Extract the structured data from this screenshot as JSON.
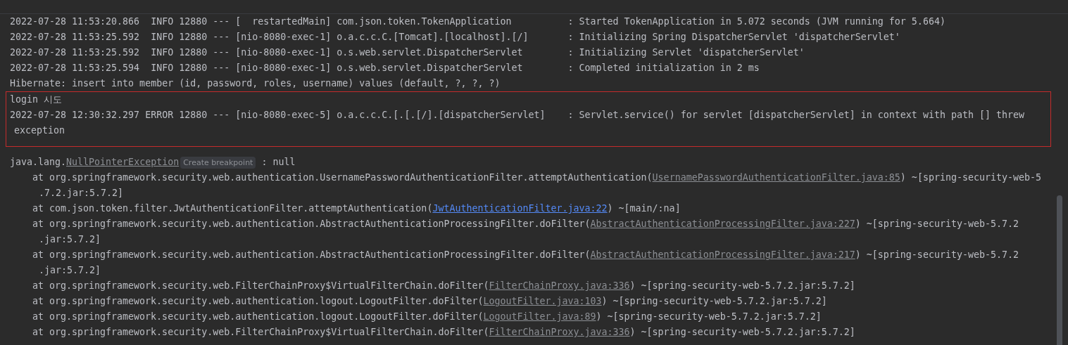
{
  "console": {
    "lines": [
      {
        "kind": "log",
        "boxed": false,
        "parts": [
          {
            "kind": "text",
            "text": "2022-07-28 11:53:20.866  INFO 12880 --- [  restartedMain] com.json.token.TokenApplication          : Started TokenApplication in 5.072 seconds (JVM running for 5.664)"
          }
        ]
      },
      {
        "kind": "log",
        "boxed": false,
        "parts": [
          {
            "kind": "text",
            "text": "2022-07-28 11:53:25.592  INFO 12880 --- [nio-8080-exec-1] o.a.c.c.C.[Tomcat].[localhost].[/]       : Initializing Spring DispatcherServlet 'dispatcherServlet'"
          }
        ]
      },
      {
        "kind": "log",
        "boxed": false,
        "parts": [
          {
            "kind": "text",
            "text": "2022-07-28 11:53:25.592  INFO 12880 --- [nio-8080-exec-1] o.s.web.servlet.DispatcherServlet        : Initializing Servlet 'dispatcherServlet'"
          }
        ]
      },
      {
        "kind": "log",
        "boxed": false,
        "parts": [
          {
            "kind": "text",
            "text": "2022-07-28 11:53:25.594  INFO 12880 --- [nio-8080-exec-1] o.s.web.servlet.DispatcherServlet        : Completed initialization in 2 ms"
          }
        ]
      },
      {
        "kind": "log",
        "boxed": false,
        "parts": [
          {
            "kind": "text",
            "text": "Hibernate: insert into member (id, password, roles, username) values (default, ?, ?, ?)"
          }
        ]
      },
      {
        "kind": "log",
        "boxed": true,
        "parts": [
          {
            "kind": "text",
            "text": "login 시도"
          }
        ]
      },
      {
        "kind": "log",
        "boxed": true,
        "parts": [
          {
            "kind": "text",
            "text": "2022-07-28 12:30:32.297 ERROR 12880 --- [nio-8080-exec-5] o.a.c.c.C.[.[.[/].[dispatcherServlet]    : Servlet.service() for servlet [dispatcherServlet] in context with path [] threw"
          }
        ]
      },
      {
        "kind": "wrap",
        "boxed": true,
        "parts": [
          {
            "kind": "text",
            "text": "exception"
          }
        ]
      },
      {
        "kind": "log",
        "boxed": false,
        "parts": [
          {
            "kind": "text",
            "text": "java.lang."
          },
          {
            "kind": "library-link",
            "text": "NullPointerException"
          },
          {
            "kind": "hint",
            "text": "Create breakpoint"
          },
          {
            "kind": "text",
            "text": " : null"
          }
        ]
      },
      {
        "kind": "frame",
        "boxed": false,
        "parts": [
          {
            "kind": "text",
            "text": "at org.springframework.security.web.authentication.UsernamePasswordAuthenticationFilter.attemptAuthentication("
          },
          {
            "kind": "library-link",
            "text": "UsernamePasswordAuthenticationFilter.java:85"
          },
          {
            "kind": "text",
            "text": ") ~[spring-security-web-5"
          }
        ]
      },
      {
        "kind": "frame-wrap",
        "boxed": false,
        "parts": [
          {
            "kind": "text",
            "text": ".7.2.jar:5.7.2]"
          }
        ]
      },
      {
        "kind": "frame",
        "boxed": false,
        "parts": [
          {
            "kind": "text",
            "text": "at com.json.token.filter.JwtAuthenticationFilter.attemptAuthentication("
          },
          {
            "kind": "source-link",
            "text": "JwtAuthenticationFilter.java:22"
          },
          {
            "kind": "text",
            "text": ") ~[main/:na]"
          }
        ]
      },
      {
        "kind": "frame",
        "boxed": false,
        "parts": [
          {
            "kind": "text",
            "text": "at org.springframework.security.web.authentication.AbstractAuthenticationProcessingFilter.doFilter("
          },
          {
            "kind": "library-link",
            "text": "AbstractAuthenticationProcessingFilter.java:227"
          },
          {
            "kind": "text",
            "text": ") ~[spring-security-web-5.7.2"
          }
        ]
      },
      {
        "kind": "frame-wrap",
        "boxed": false,
        "parts": [
          {
            "kind": "text",
            "text": ".jar:5.7.2]"
          }
        ]
      },
      {
        "kind": "frame",
        "boxed": false,
        "parts": [
          {
            "kind": "text",
            "text": "at org.springframework.security.web.authentication.AbstractAuthenticationProcessingFilter.doFilter("
          },
          {
            "kind": "library-link",
            "text": "AbstractAuthenticationProcessingFilter.java:217"
          },
          {
            "kind": "text",
            "text": ") ~[spring-security-web-5.7.2"
          }
        ]
      },
      {
        "kind": "frame-wrap",
        "boxed": false,
        "parts": [
          {
            "kind": "text",
            "text": ".jar:5.7.2]"
          }
        ]
      },
      {
        "kind": "frame",
        "boxed": false,
        "parts": [
          {
            "kind": "text",
            "text": "at org.springframework.security.web.FilterChainProxy$VirtualFilterChain.doFilter("
          },
          {
            "kind": "library-link",
            "text": "FilterChainProxy.java:336"
          },
          {
            "kind": "text",
            "text": ") ~[spring-security-web-5.7.2.jar:5.7.2]"
          }
        ]
      },
      {
        "kind": "frame",
        "boxed": false,
        "parts": [
          {
            "kind": "text",
            "text": "at org.springframework.security.web.authentication.logout.LogoutFilter.doFilter("
          },
          {
            "kind": "library-link",
            "text": "LogoutFilter.java:103"
          },
          {
            "kind": "text",
            "text": ") ~[spring-security-web-5.7.2.jar:5.7.2]"
          }
        ]
      },
      {
        "kind": "frame",
        "boxed": false,
        "parts": [
          {
            "kind": "text",
            "text": "at org.springframework.security.web.authentication.logout.LogoutFilter.doFilter("
          },
          {
            "kind": "library-link",
            "text": "LogoutFilter.java:89"
          },
          {
            "kind": "text",
            "text": ") ~[spring-security-web-5.7.2.jar:5.7.2]"
          }
        ]
      },
      {
        "kind": "frame",
        "boxed": false,
        "parts": [
          {
            "kind": "text",
            "text": "at org.springframework.security.web.FilterChainProxy$VirtualFilterChain.doFilter("
          },
          {
            "kind": "library-link",
            "text": "FilterChainProxy.java:336"
          },
          {
            "kind": "text",
            "text": ") ~[spring-security-web-5.7.2.jar:5.7.2]"
          }
        ]
      }
    ]
  }
}
